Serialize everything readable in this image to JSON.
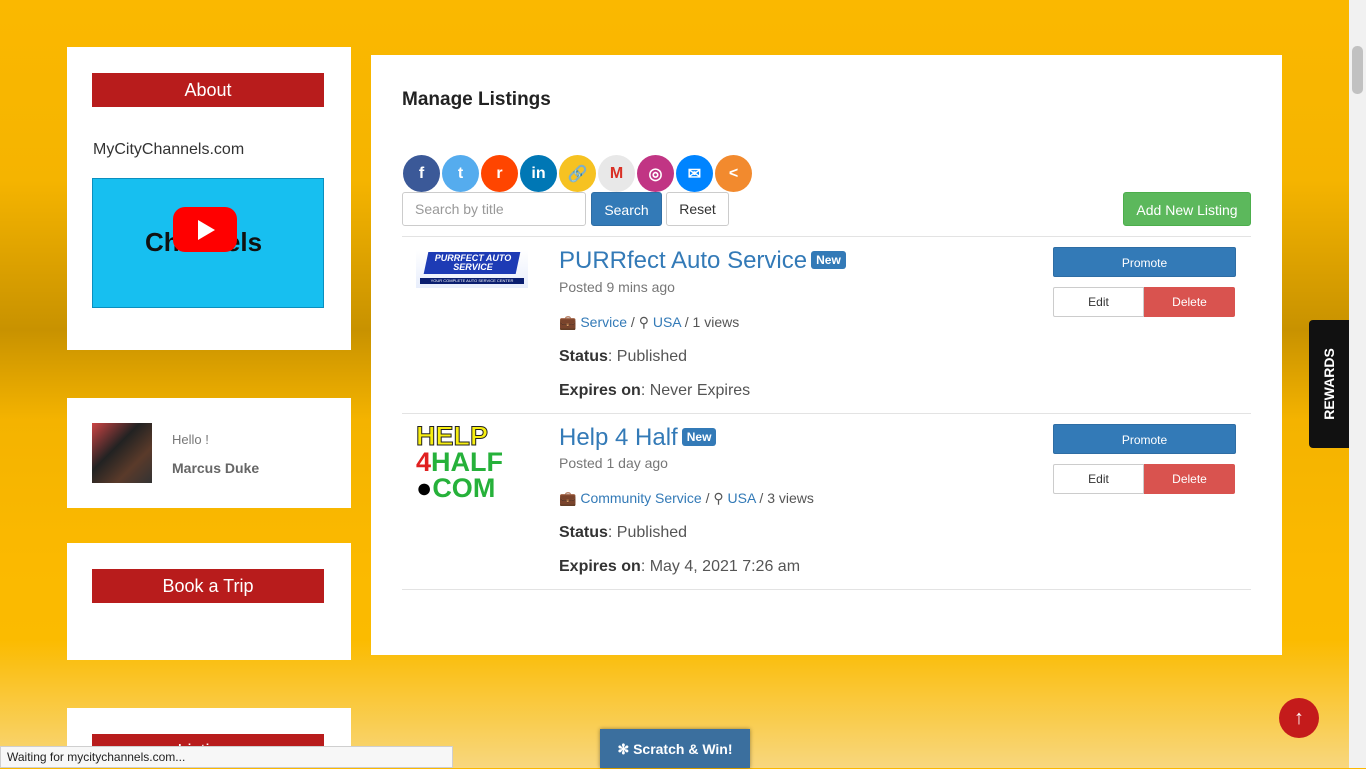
{
  "sidebar": {
    "about": {
      "heading": "About",
      "site": "MyCityChannels.com",
      "video_text": "Channels"
    },
    "user": {
      "greeting": "Hello !",
      "name": "Marcus Duke"
    },
    "trip": {
      "heading": "Book a Trip"
    },
    "listings": {
      "heading": "Listings"
    }
  },
  "main": {
    "title": "Manage Listings",
    "share_icons": [
      {
        "name": "facebook-icon",
        "glyph": "f",
        "color": "#3b5998"
      },
      {
        "name": "twitter-icon",
        "glyph": "t",
        "color": "#55acee"
      },
      {
        "name": "reddit-icon",
        "glyph": "r",
        "color": "#ff4500"
      },
      {
        "name": "linkedin-icon",
        "glyph": "in",
        "color": "#0077b5"
      },
      {
        "name": "copy-link-icon",
        "glyph": "🔗",
        "color": "#f6c221"
      },
      {
        "name": "gmail-icon",
        "glyph": "M",
        "color": "#e8e8e8"
      },
      {
        "name": "instagram-icon",
        "glyph": "◎",
        "color": "#c13584"
      },
      {
        "name": "messenger-icon",
        "glyph": "✉",
        "color": "#0084ff"
      },
      {
        "name": "more-share-icon",
        "glyph": "<",
        "color": "#f28a2e"
      }
    ],
    "search": {
      "placeholder": "Search by title",
      "search_label": "Search",
      "reset_label": "Reset"
    },
    "add_label": "Add New Listing",
    "listings": [
      {
        "title": "PURRfect Auto Service",
        "badge": "New",
        "posted": "Posted 9 mins ago",
        "category": "Service",
        "location": "USA",
        "views": "1 views",
        "status_label": "Status",
        "status": "Published",
        "expires_label": "Expires on",
        "expires": "Never Expires",
        "thumb_text": "PURRFECT AUTO SERVICE",
        "thumb_sub": "YOUR COMPLETE AUTO SERVICE CENTER",
        "promote": "Promote",
        "edit": "Edit",
        "delete": "Delete"
      },
      {
        "title": "Help 4 Half",
        "badge": "New",
        "posted": "Posted 1 day ago",
        "category": "Community Service",
        "location": "USA",
        "views": "3 views",
        "status_label": "Status",
        "status": "Published",
        "expires_label": "Expires on",
        "expires": "May 4, 2021 7:26 am",
        "thumb_text": "HELP 4HALF .COM",
        "promote": "Promote",
        "edit": "Edit",
        "delete": "Delete"
      }
    ]
  },
  "widgets": {
    "rewards": "REWARDS",
    "scratch": "Scratch & Win!",
    "totop": "↑",
    "status_bar": "Waiting for mycitychannels.com..."
  }
}
